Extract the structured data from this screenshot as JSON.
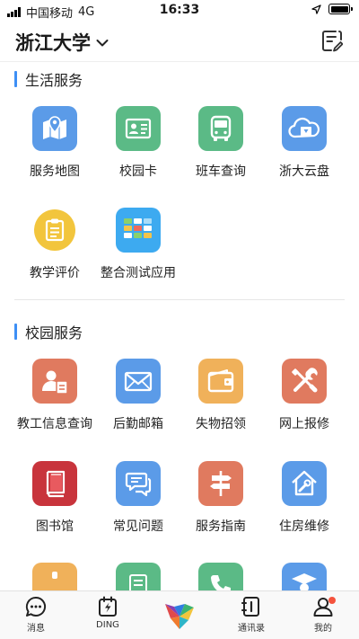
{
  "status_bar": {
    "carrier": "中国移动",
    "network": "4G",
    "time": "16:33"
  },
  "header": {
    "org_name": "浙江大学"
  },
  "sections": [
    {
      "title": "生活服务",
      "apps": [
        {
          "label": "服务地图",
          "icon": "map-icon",
          "color": "#5b9be8"
        },
        {
          "label": "校园卡",
          "icon": "id-card-icon",
          "color": "#5bba86"
        },
        {
          "label": "班车查询",
          "icon": "bus-icon",
          "color": "#5bba86"
        },
        {
          "label": "浙大云盘",
          "icon": "cloud-disk-icon",
          "color": "#5b9be8"
        },
        {
          "label": "教学评价",
          "icon": "evaluation-icon",
          "color": "#f2c53d"
        },
        {
          "label": "整合测试应用",
          "icon": "test-app-icon",
          "color": "#3daaf0"
        }
      ]
    },
    {
      "title": "校园服务",
      "apps": [
        {
          "label": "教工信息查询",
          "icon": "staff-info-icon",
          "color": "#e07a5f"
        },
        {
          "label": "后勤邮箱",
          "icon": "mail-icon",
          "color": "#5b9be8"
        },
        {
          "label": "失物招领",
          "icon": "wallet-icon",
          "color": "#f0b15a"
        },
        {
          "label": "网上报修",
          "icon": "repair-tools-icon",
          "color": "#e07a5f"
        },
        {
          "label": "图书馆",
          "icon": "library-book-icon",
          "color": "#c8343c"
        },
        {
          "label": "常见问题",
          "icon": "faq-chat-icon",
          "color": "#5b9be8"
        },
        {
          "label": "服务指南",
          "icon": "signpost-icon",
          "color": "#e07a5f"
        },
        {
          "label": "住房维修",
          "icon": "house-repair-icon",
          "color": "#5b9be8"
        }
      ]
    }
  ],
  "tabbar": {
    "items": [
      {
        "label": "消息",
        "icon": "message-icon"
      },
      {
        "label": "DING",
        "icon": "ding-icon"
      },
      {
        "label": "",
        "icon": "workbench-logo"
      },
      {
        "label": "通讯录",
        "icon": "contacts-icon"
      },
      {
        "label": "我的",
        "icon": "profile-icon"
      }
    ]
  }
}
